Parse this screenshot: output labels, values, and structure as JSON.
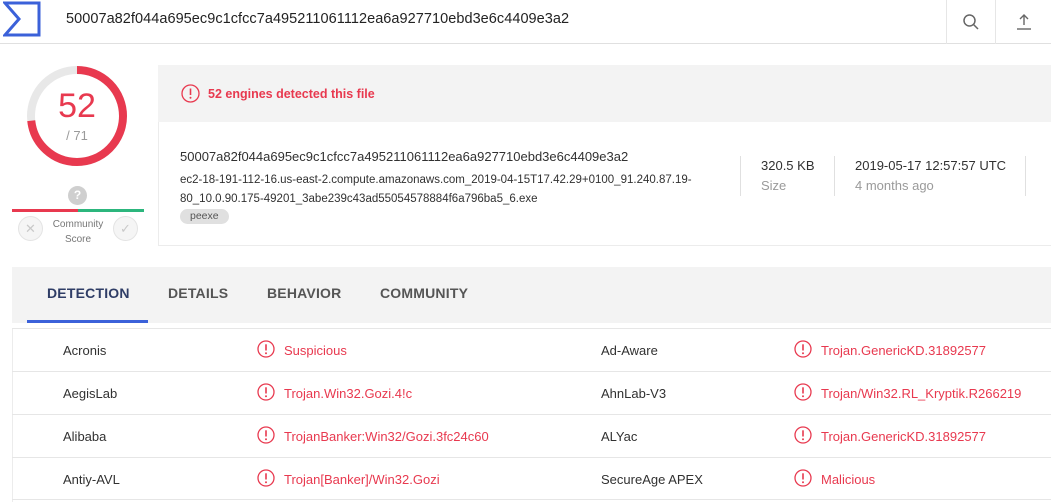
{
  "search": {
    "query": "50007a82f044a695ec9c1cfcc7a495211061112ea6a927710ebd3e6c4409e3a2"
  },
  "score": {
    "detected": "52",
    "total": "/ 71",
    "color": "#e8394f"
  },
  "community": {
    "label_line1": "Community",
    "label_line2": "Score",
    "question": "?"
  },
  "detection_banner": {
    "text": "52 engines detected this file"
  },
  "file": {
    "hash": "50007a82f044a695ec9c1cfcc7a495211061112ea6a927710ebd3e6c4409e3a2",
    "name_line1": "ec2-18-191-112-16.us-east-2.compute.amazonaws.com_2019-04-15T17.42.29+0100_91.240.87.19-",
    "name_line2": "80_10.0.90.175-49201_3abe239c43ad55054578884f6a796ba5_6.exe",
    "tag": "peexe",
    "size": "320.5 KB",
    "size_label": "Size",
    "date": "2019-05-17 12:57:57 UTC",
    "date_label": "4 months ago"
  },
  "tabs": [
    {
      "label": "DETECTION"
    },
    {
      "label": "DETAILS"
    },
    {
      "label": "BEHAVIOR"
    },
    {
      "label": "COMMUNITY"
    }
  ],
  "detections": [
    {
      "engine_a": "Acronis",
      "result_a": "Suspicious",
      "engine_b": "Ad-Aware",
      "result_b": "Trojan.GenericKD.31892577"
    },
    {
      "engine_a": "AegisLab",
      "result_a": "Trojan.Win32.Gozi.4!c",
      "engine_b": "AhnLab-V3",
      "result_b": "Trojan/Win32.RL_Kryptik.R266219"
    },
    {
      "engine_a": "Alibaba",
      "result_a": "TrojanBanker:Win32/Gozi.3fc24c60",
      "engine_b": "ALYac",
      "result_b": "Trojan.GenericKD.31892577"
    },
    {
      "engine_a": "Antiy-AVL",
      "result_a": "Trojan[Banker]/Win32.Gozi",
      "engine_b": "SecureAge APEX",
      "result_b": "Malicious"
    }
  ],
  "icons": {
    "logo": "virustotal-logo-icon",
    "search": "search-icon",
    "upload": "upload-icon",
    "alert": "alert-circle-icon",
    "close": "close-icon",
    "check": "check-icon"
  }
}
